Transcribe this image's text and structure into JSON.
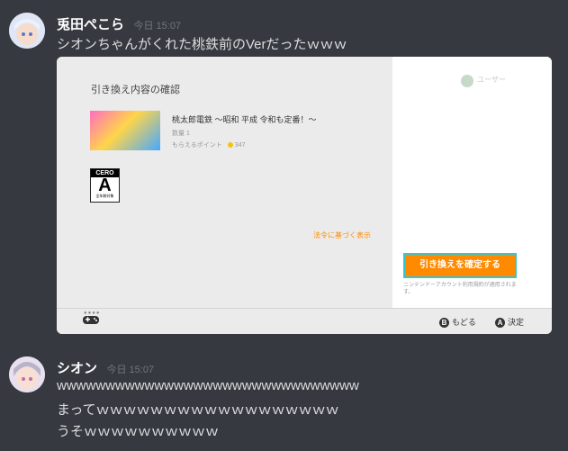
{
  "messages": [
    {
      "username": "兎田ぺこら",
      "timestamp": "今日 15:07",
      "lines": [
        "シオンちゃんがくれた桃鉄前のVerだったｗｗｗ"
      ],
      "embed": {
        "section_title": "引き換え内容の確認",
        "game_title": "桃太郎電鉄 ～昭和 平成 令和も定番！～",
        "quantity": "数量 1",
        "points_label": "もらえるポイント",
        "points_value": "347",
        "rating": {
          "top": "CERO",
          "letter": "A",
          "bottom": "全年齢対象"
        },
        "legal_link": "法令に基づく表示",
        "user_name": "ユーザー",
        "confirm_button": "引き換えを確定する",
        "account_note": "ニンテンドーアカウント利用規約が適用されます。",
        "hint_back": {
          "key": "B",
          "label": "もどる"
        },
        "hint_ok": {
          "key": "A",
          "label": "決定"
        }
      }
    },
    {
      "username": "シオン",
      "timestamp": "今日 15:07",
      "lines": [
        "wwwwwwwwwwwwwwwwwwwwwwwwwwwwwww",
        "まってｗｗｗｗｗｗｗｗｗｗｗｗｗｗｗｗｗｗ",
        "うそｗｗｗｗｗｗｗｗｗｗ"
      ]
    }
  ],
  "colors": {
    "background": "#36393f",
    "accent_orange": "#ff8a00",
    "focus_cyan": "#34c6d4"
  }
}
